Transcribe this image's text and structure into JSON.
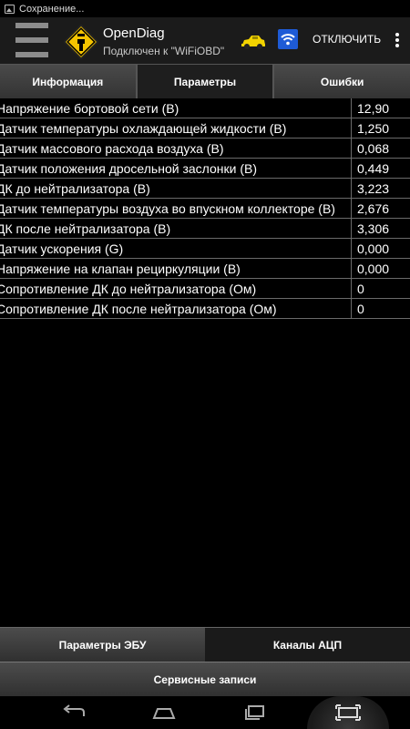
{
  "status_bar": {
    "text": "Сохранение..."
  },
  "action_bar": {
    "title": "OpenDiag",
    "subtitle": "Подключен к \"WiFiOBD\"",
    "disconnect_label": "ОТКЛЮЧИТЬ",
    "icons": [
      "menu-icon",
      "app-logo-icon",
      "car-icon",
      "wifi-icon",
      "overflow-icon"
    ]
  },
  "tabs": [
    {
      "label": "Информация",
      "active": false
    },
    {
      "label": "Параметры",
      "active": true
    },
    {
      "label": "Ошибки",
      "active": false
    }
  ],
  "params": [
    {
      "name": "Напряжение бортовой сети (В)",
      "value": "12,90"
    },
    {
      "name": "Датчик температуры охлаждающей жидкости (В)",
      "value": "1,250"
    },
    {
      "name": "Датчик массового расхода воздуха (В)",
      "value": "0,068"
    },
    {
      "name": "Датчик положения дросельной заслонки (В)",
      "value": "0,449"
    },
    {
      "name": "ДК до нейтрализатора (В)",
      "value": "3,223"
    },
    {
      "name": "Датчик температуры воздуха во впускном коллекторе (В)",
      "value": "2,676"
    },
    {
      "name": "ДК после нейтрализатора (В)",
      "value": "3,306"
    },
    {
      "name": "Датчик ускорения (G)",
      "value": "0,000"
    },
    {
      "name": "Напряжение на клапан рециркуляции (В)",
      "value": "0,000"
    },
    {
      "name": "Сопротивление ДК до нейтрализатора (Ом)",
      "value": "0"
    },
    {
      "name": "Сопротивление ДК после нейтрализатора (Ом)",
      "value": "0"
    }
  ],
  "bottom_tabs": [
    {
      "label": "Параметры ЭБУ",
      "active": false
    },
    {
      "label": "Каналы АЦП",
      "active": true
    }
  ],
  "service_button": {
    "label": "Сервисные записи"
  },
  "colors": {
    "background": "#000000",
    "logo_yellow": "#f5c400",
    "car_yellow": "#f3d300",
    "wifi_blue": "#1e5bd6"
  }
}
